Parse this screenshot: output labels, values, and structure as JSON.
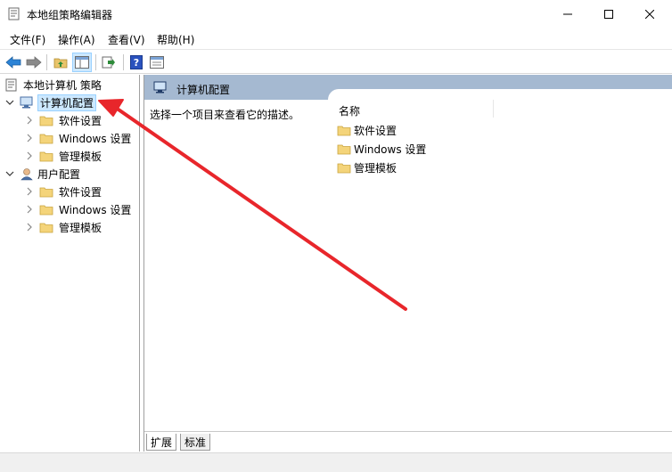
{
  "window": {
    "title": "本地组策略编辑器"
  },
  "menu": [
    {
      "label": "文件(F)"
    },
    {
      "label": "操作(A)"
    },
    {
      "label": "查看(V)"
    },
    {
      "label": "帮助(H)"
    }
  ],
  "tree": {
    "root": "本地计算机 策略",
    "computer_config": {
      "label": "计算机配置",
      "children": [
        "软件设置",
        "Windows 设置",
        "管理模板"
      ]
    },
    "user_config": {
      "label": "用户配置",
      "children": [
        "软件设置",
        "Windows 设置",
        "管理模板"
      ]
    }
  },
  "detail": {
    "header_title": "计算机配置",
    "description": "选择一个项目来查看它的描述。",
    "column_name": "名称",
    "items": [
      "软件设置",
      "Windows 设置",
      "管理模板"
    ]
  },
  "tabs": [
    "扩展",
    "标准"
  ],
  "colors": {
    "header_bar": "#a5b9d1",
    "selection": "#cce8ff",
    "annotation_arrow": "#e8262b"
  }
}
